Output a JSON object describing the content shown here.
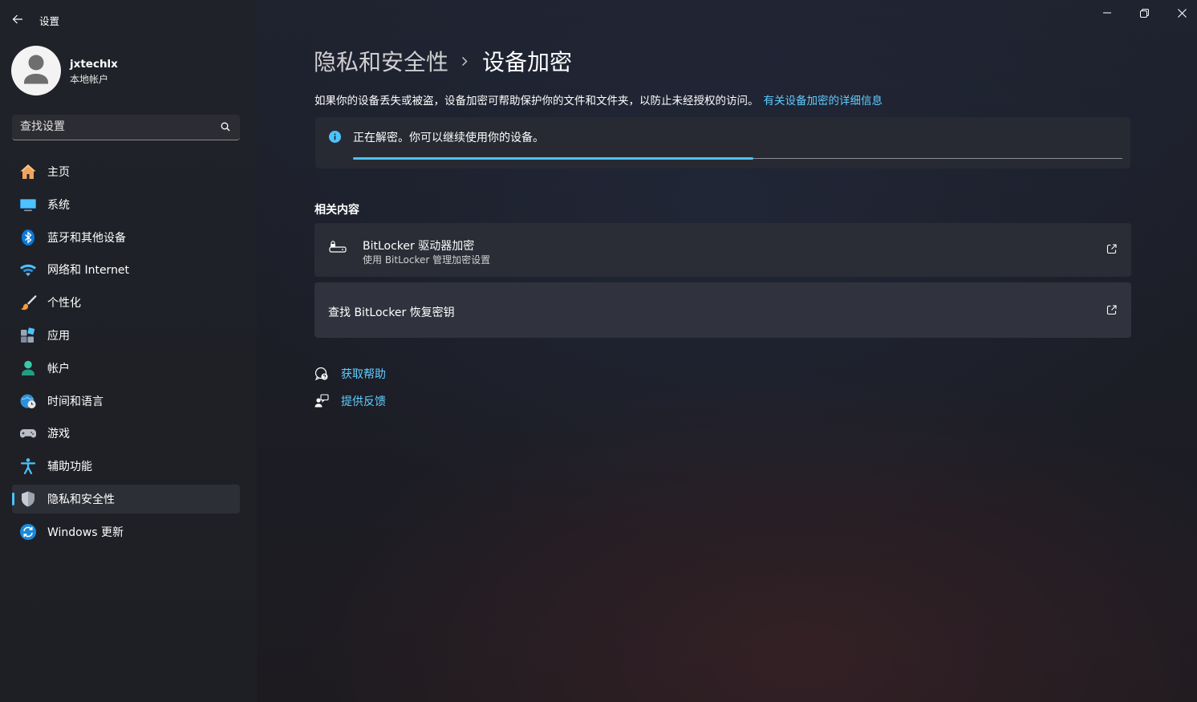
{
  "window": {
    "title": "设置"
  },
  "profile": {
    "name": "jxtechlx",
    "account_type": "本地帐户"
  },
  "search": {
    "placeholder": "查找设置"
  },
  "sidebar": {
    "items": [
      {
        "label": "主页",
        "icon": "home-icon"
      },
      {
        "label": "系统",
        "icon": "system-display-icon"
      },
      {
        "label": "蓝牙和其他设备",
        "icon": "bluetooth-icon"
      },
      {
        "label": "网络和 Internet",
        "icon": "wifi-icon"
      },
      {
        "label": "个性化",
        "icon": "brush-icon"
      },
      {
        "label": "应用",
        "icon": "apps-icon"
      },
      {
        "label": "帐户",
        "icon": "account-icon"
      },
      {
        "label": "时间和语言",
        "icon": "globe-clock-icon"
      },
      {
        "label": "游戏",
        "icon": "gamepad-icon"
      },
      {
        "label": "辅助功能",
        "icon": "accessibility-icon"
      },
      {
        "label": "隐私和安全性",
        "icon": "shield-icon",
        "active": true
      },
      {
        "label": "Windows 更新",
        "icon": "update-icon"
      }
    ]
  },
  "main": {
    "breadcrumb_parent": "隐私和安全性",
    "breadcrumb_current": "设备加密",
    "description": "如果你的设备丢失或被盗，设备加密可帮助保护你的文件和文件夹，以防止未经授权的访问。",
    "details_link": "有关设备加密的详细信息",
    "status": {
      "text": "正在解密。你可以继续使用你的设备。",
      "progress": 0.52
    },
    "related_title": "相关内容",
    "cards": [
      {
        "title": "BitLocker 驱动器加密",
        "subtitle": "使用 BitLocker 管理加密设置"
      },
      {
        "title": "查找 BitLocker 恢复密钥",
        "subtitle": ""
      }
    ],
    "help_links": [
      {
        "label": "获取帮助"
      },
      {
        "label": "提供反馈"
      }
    ]
  },
  "colors": {
    "accent": "#4cc2ff",
    "link": "#60cdff",
    "info_badge": "#4cc2ff"
  }
}
